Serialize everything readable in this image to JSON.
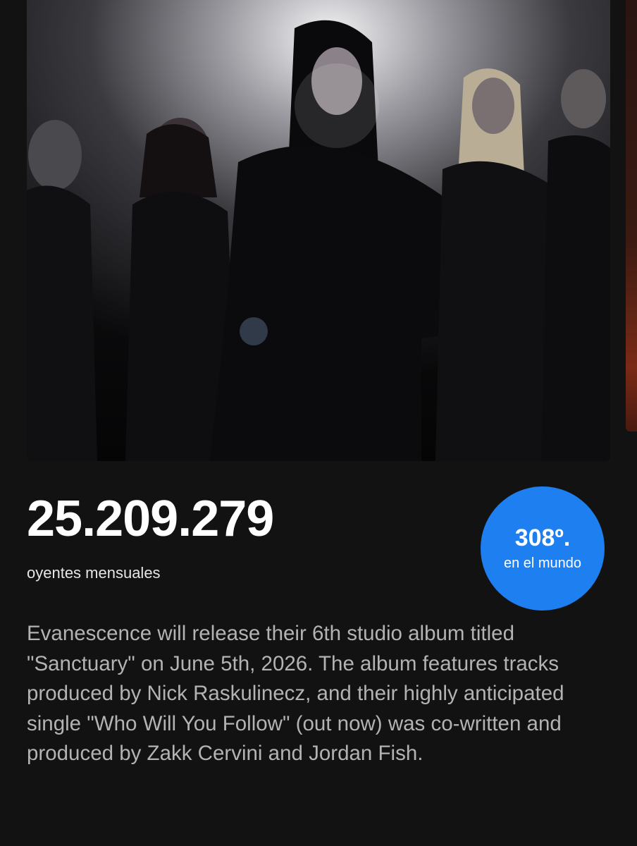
{
  "artist": {
    "monthly_listeners": "25.209.279",
    "monthly_listeners_label": "oyentes mensuales",
    "world_rank": "308º.",
    "world_rank_label": "en el mundo",
    "bio": "Evanescence will release their 6th studio album titled \"Sanctuary\" on June 5th, 2026. The album features tracks produced by Nick Raskulinecz, and their highly anticipated single \"Who Will You Follow\" (out now) was co-written and produced by Zakk Cervini and Jordan Fish."
  },
  "colors": {
    "background": "#121212",
    "rank_badge": "#1e7ff0",
    "text_primary": "#ffffff",
    "text_secondary": "#b3b3b3"
  }
}
